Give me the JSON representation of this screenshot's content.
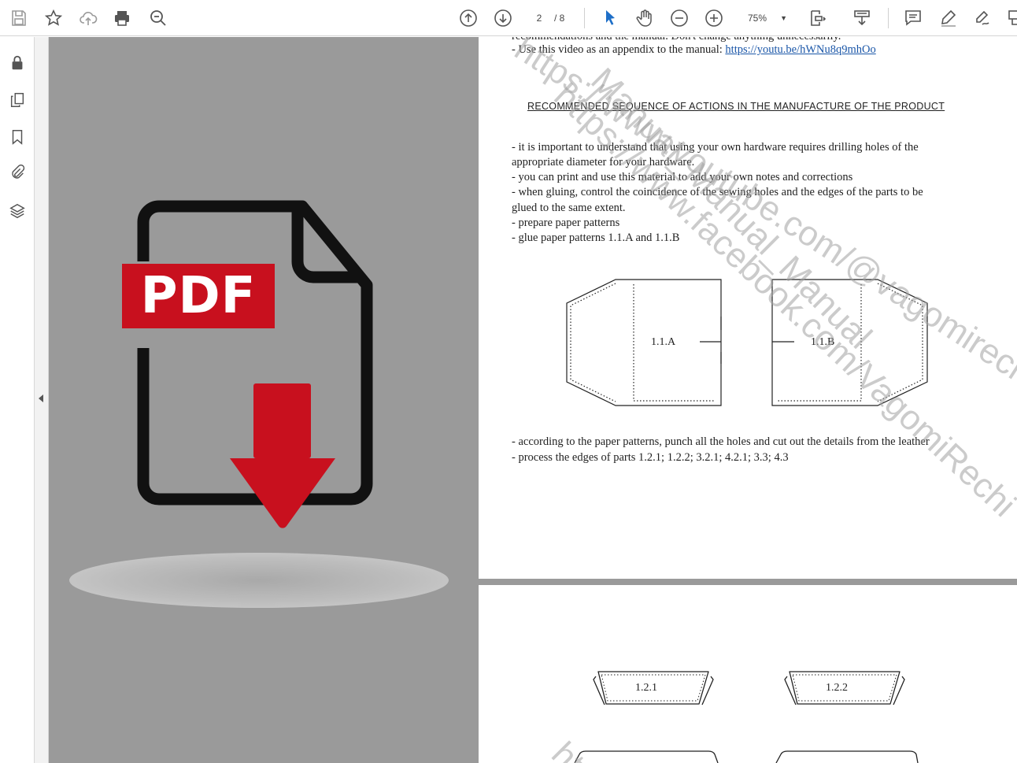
{
  "toolbar": {
    "page_current": "2",
    "page_total": "/ 8",
    "zoom": "75%",
    "icons": [
      "save-icon",
      "star-icon",
      "cloud-upload-icon",
      "print-icon",
      "zoom-search-icon",
      "page-up-icon",
      "page-down-icon",
      "select-arrow-icon",
      "hand-icon",
      "zoom-out-icon",
      "zoom-in-icon",
      "fit-page-icon",
      "scroll-mode-icon",
      "comment-icon",
      "highlight-icon",
      "sign-icon",
      "share-icon"
    ]
  },
  "sidebar": {
    "icons": [
      "lock-icon",
      "pages-icon",
      "bookmark-icon",
      "attachment-icon",
      "layers-icon"
    ]
  },
  "preview": {
    "badge": "PDF",
    "colors": {
      "badge": "#c8101e",
      "arrow": "#c8101e",
      "outline": "#111111",
      "background": "#9a9a9a"
    }
  },
  "page1": {
    "cut_line": "recommendations and the manual. Don't change anything unnecessarily.",
    "video_prefix": " - Use this video as an appendix to the manual: ",
    "video_link": "https://youtu.be/hWNu8q9mhOo",
    "heading": "RECOMMENDED SEQUENCE OF ACTIONS IN THE MANUFACTURE OF THE PRODUCT",
    "lines": [
      "- it is important to understand that using your own hardware requires drilling holes of the",
      "appropriate diameter for your hardware.",
      "- you can print and use this material to add your own notes and corrections",
      "- when gluing, control the coincidence of the sewing holes and the edges of the parts to be",
      "glued to the same extent.",
      "- prepare paper patterns",
      "- glue paper patterns 1.1.A and 1.1.B"
    ],
    "pattern_labels": [
      "1.1.A",
      "1.1.B"
    ],
    "after_lines": [
      "- according to the paper patterns, punch all the holes and cut out the details from the leather",
      "- process the edges of parts 1.2.1; 1.2.2; 3.2.1; 4.2.1; 3.3; 4.3"
    ],
    "watermarks": [
      "https://www.youtube.com/@vagomirechi",
      "Manual_Manual_Manual",
      "https://www.facebook.com/VagomiRechi"
    ]
  },
  "page2": {
    "pattern_labels": [
      "1.2.1",
      "1.2.2"
    ],
    "watermark": "htt"
  }
}
